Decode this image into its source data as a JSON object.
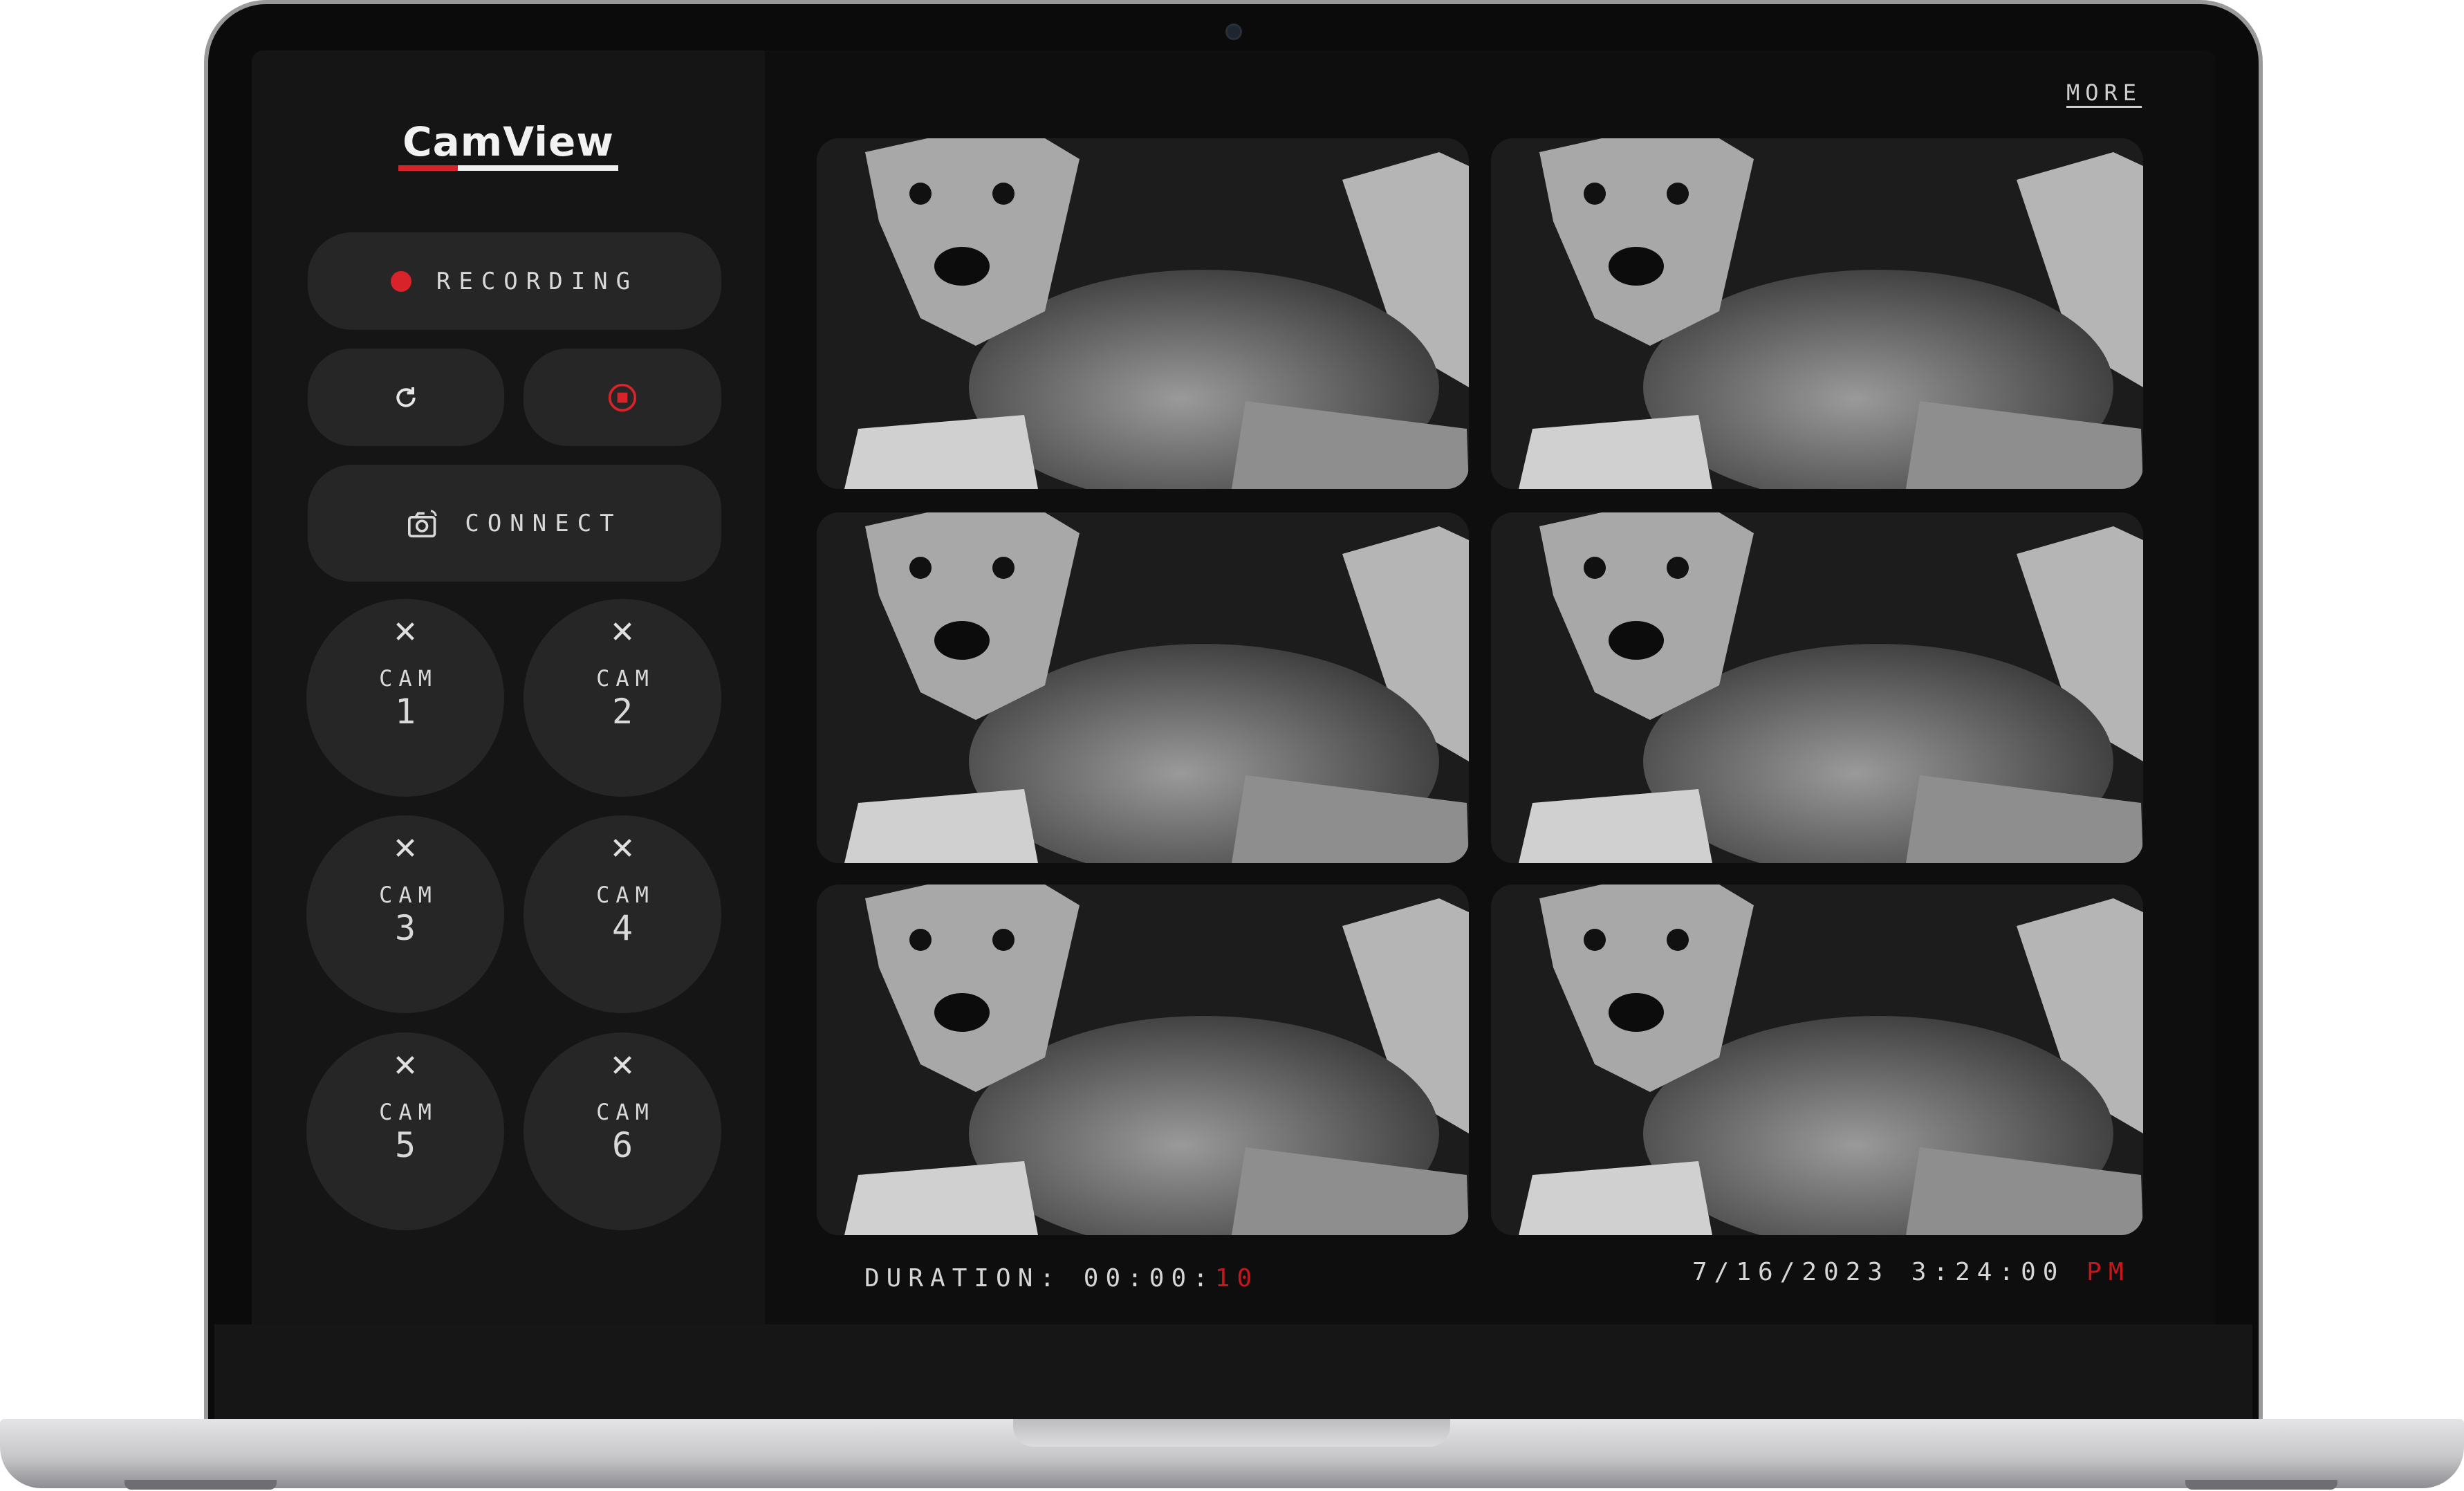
{
  "app": {
    "logo_text": "CamView"
  },
  "sidebar": {
    "recording_label": "RECORDING",
    "connect_label": "CONNECT",
    "refresh_icon": "refresh-icon",
    "stop_icon": "stop-record-icon",
    "cameras": [
      {
        "label": "CAM",
        "number": "1"
      },
      {
        "label": "CAM",
        "number": "2"
      },
      {
        "label": "CAM",
        "number": "3"
      },
      {
        "label": "CAM",
        "number": "4"
      },
      {
        "label": "CAM",
        "number": "5"
      },
      {
        "label": "CAM",
        "number": "6"
      }
    ],
    "remove_glyph": "✕"
  },
  "header": {
    "more_label": "MORE"
  },
  "status": {
    "duration_label": "DURATION:",
    "duration_main": "00:00:",
    "duration_seconds": "10",
    "datetime": "7/16/2023 3:24:00",
    "ampm": "PM"
  },
  "colors": {
    "accent": "#d8232a",
    "sidebar": "#151515",
    "main": "#0e0e0e",
    "button": "#262626"
  }
}
